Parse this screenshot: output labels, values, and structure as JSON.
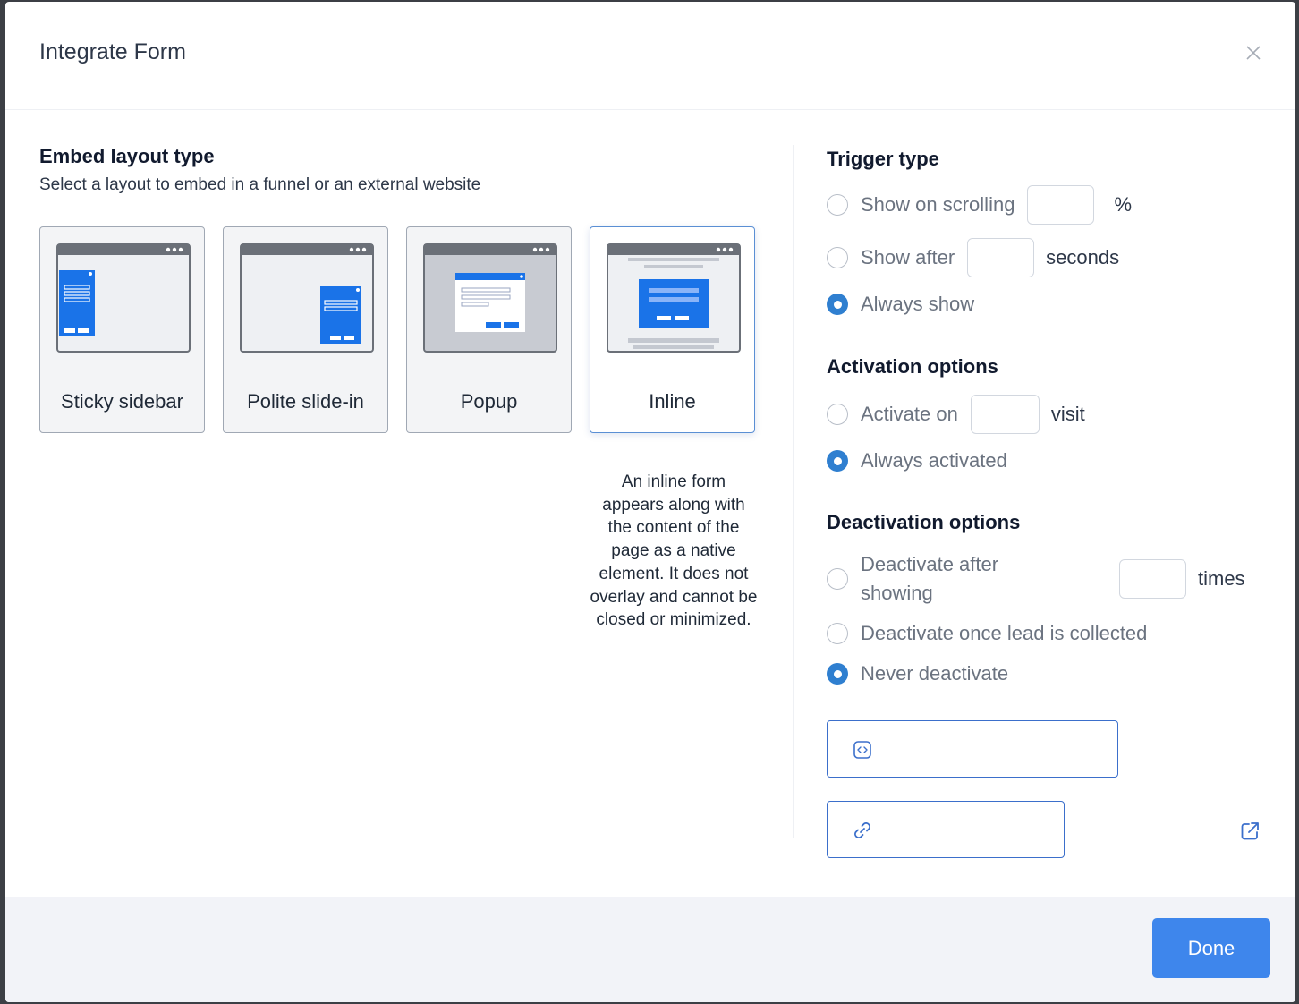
{
  "dialog": {
    "title": "Integrate Form"
  },
  "embed": {
    "heading": "Embed layout type",
    "subheading": "Select a layout to embed in a funnel or an external website",
    "cards": [
      {
        "label": "Sticky sidebar",
        "selected": false
      },
      {
        "label": "Polite slide-in",
        "selected": false
      },
      {
        "label": "Popup",
        "selected": false
      },
      {
        "label": "Inline",
        "selected": true
      }
    ],
    "description": "An inline form appears along with the content of the page as a native element. It does not overlay and cannot be closed or minimized."
  },
  "trigger": {
    "heading": "Trigger type",
    "scrolling_label": "Show on scrolling",
    "scrolling_unit": "%",
    "scrolling_value": "",
    "after_label": "Show after",
    "after_unit": "seconds",
    "after_value": "",
    "always_label": "Always show",
    "selected": "Always show"
  },
  "activation": {
    "heading": "Activation options",
    "activate_on_label": "Activate on",
    "activate_on_unit": "visit",
    "activate_on_value": "",
    "always_label": "Always activated",
    "selected": "Always activated"
  },
  "deactivation": {
    "heading": "Deactivation options",
    "after_showing_label_1": "Deactivate after",
    "after_showing_label_2": "showing",
    "after_showing_unit": "times",
    "after_showing_value": "",
    "lead_label": "Deactivate once lead is collected",
    "never_label": "Never deactivate",
    "selected": "Never deactivate"
  },
  "icons": {
    "close": "close-icon",
    "code": "code-icon",
    "link": "link-icon",
    "external": "external-link-icon"
  },
  "colors": {
    "accent": "#3e86ec",
    "radio_on": "#2f7fd0",
    "form_blue": "#1a73e8"
  },
  "footer": {
    "done_label": "Done"
  }
}
